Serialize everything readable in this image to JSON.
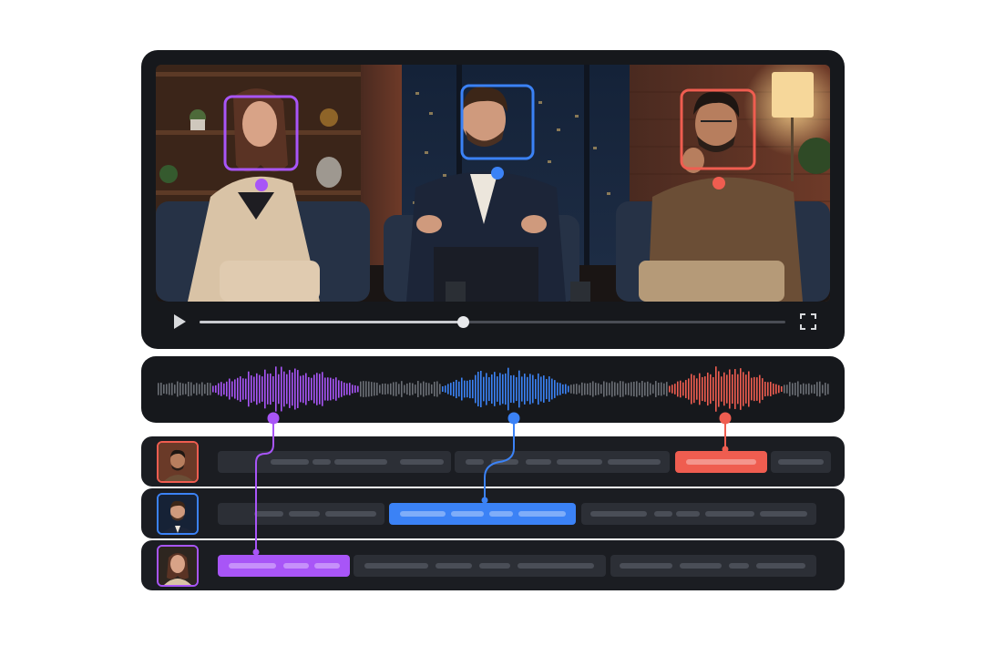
{
  "colors": {
    "purple": "#a855f7",
    "blue": "#3b82f6",
    "red": "#ef5d50",
    "gray_wave": "#6b6e75"
  },
  "player": {
    "progress": 0.45,
    "play_icon": "play-icon",
    "fullscreen_icon": "fullscreen-icon"
  },
  "speakers": [
    {
      "id": "speaker-woman",
      "color": "purple"
    },
    {
      "id": "speaker-center-man",
      "color": "blue"
    },
    {
      "id": "speaker-right-man",
      "color": "red"
    }
  ],
  "rows": [
    {
      "speaker": "speaker-right-man",
      "active_segment": 2
    },
    {
      "speaker": "speaker-center-man",
      "active_segment": 1
    },
    {
      "speaker": "speaker-woman",
      "active_segment": 0
    }
  ]
}
